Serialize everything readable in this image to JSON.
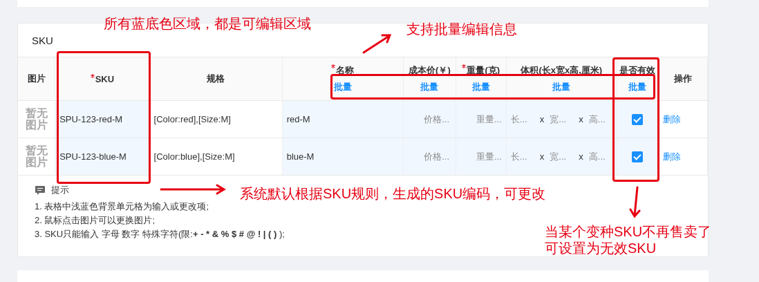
{
  "section_title": "SKU",
  "columns": [
    {
      "label": "图片",
      "required": false
    },
    {
      "label": "SKU",
      "required": true
    },
    {
      "label": "规格",
      "required": false
    },
    {
      "label": "名称",
      "required": true,
      "batch": "批量"
    },
    {
      "label": "成本价(￥)",
      "required": false,
      "batch": "批量"
    },
    {
      "label": "重量(克)",
      "required": true,
      "batch": "批量"
    },
    {
      "label": "体积(长x宽x高,厘米)",
      "required": false,
      "batch": "批量"
    },
    {
      "label": "是否有效",
      "required": false,
      "batch": "批量"
    },
    {
      "label": "操作",
      "required": false
    }
  ],
  "rows": [
    {
      "image_text": "暂无图片",
      "sku": "SPU-123-red-M",
      "spec": "[Color:red],[Size:M]",
      "name": "red-M",
      "price_placeholder": "价格...",
      "weight_placeholder": "重量...",
      "volume": {
        "length_placeholder": "长...",
        "sep1": "x",
        "width_placeholder": "宽...",
        "sep2": "x",
        "height_placeholder": "高..."
      },
      "valid": true,
      "action": "删除"
    },
    {
      "image_text": "暂无图片",
      "sku": "SPU-123-blue-M",
      "spec": "[Color:blue],[Size:M]",
      "name": "blue-M",
      "price_placeholder": "价格...",
      "weight_placeholder": "重量...",
      "volume": {
        "length_placeholder": "长...",
        "sep1": "x",
        "width_placeholder": "宽...",
        "sep2": "x",
        "height_placeholder": "高..."
      },
      "valid": true,
      "action": "删除"
    }
  ],
  "tips": {
    "title": "提示",
    "items": [
      {
        "text": "1. 表格中浅蓝色背景单元格为输入或更改项;"
      },
      {
        "text": "2. 鼠标点击图片可以更换图片;"
      },
      {
        "text": "3. SKU只能输入 字母 数字 特殊字符(限:",
        "bold": "+ - * & % $ # @ ! | ( )",
        "after": " );"
      }
    ]
  },
  "annotations": [
    {
      "text": "所有蓝底色区域，都是可编辑区域"
    },
    {
      "text": "支持批量编辑信息"
    },
    {
      "text": "系统默认根据SKU规则，生成的SKU编码，可更改"
    },
    {
      "text": "当某个变种SKU不再售卖了",
      "second_line": "可设置为无效SKU"
    }
  ]
}
